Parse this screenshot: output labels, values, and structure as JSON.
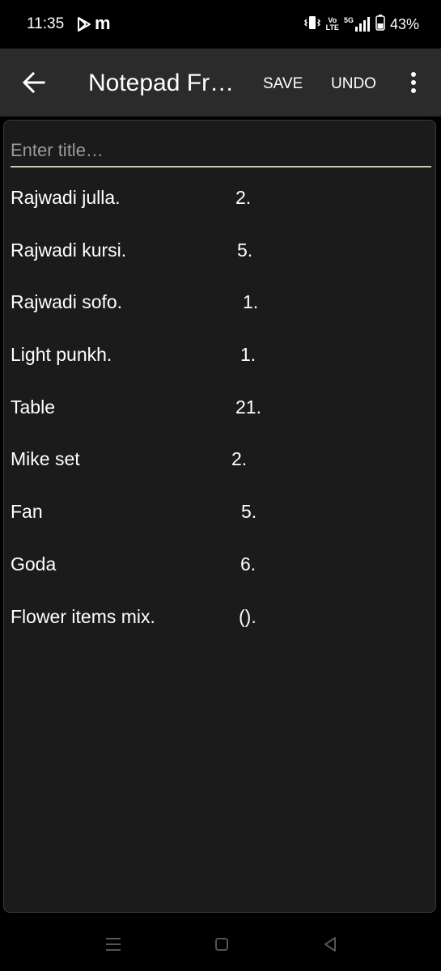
{
  "status_bar": {
    "time": "11:35",
    "notification_letter": "m",
    "volte_top": "Vo",
    "volte_bottom": "LTE",
    "network": "5G",
    "battery": "43%"
  },
  "app_bar": {
    "title": "Notepad Fr…",
    "save_label": "SAVE",
    "undo_label": "UNDO"
  },
  "editor": {
    "title_placeholder": "Enter title…",
    "title_value": "",
    "lines": [
      {
        "item": "Rajwadi julla.",
        "qty": "2."
      },
      {
        "item": "Rajwadi kursi.",
        "qty": "5."
      },
      {
        "item": "Rajwadi sofo.",
        "qty": "1."
      },
      {
        "item": "Light punkh.",
        "qty": "1."
      },
      {
        "item": "Table",
        "qty": "21."
      },
      {
        "item": "Mike set",
        "qty": "2."
      },
      {
        "item": "Fan",
        "qty": "5."
      },
      {
        "item": "Goda",
        "qty": "6."
      },
      {
        "item": "Flower items mix.",
        "qty": "()."
      }
    ]
  },
  "colors": {
    "app_bar_bg": "#2b2b2b",
    "editor_bg": "#1b1b1b",
    "underline": "#c8c9b8"
  }
}
